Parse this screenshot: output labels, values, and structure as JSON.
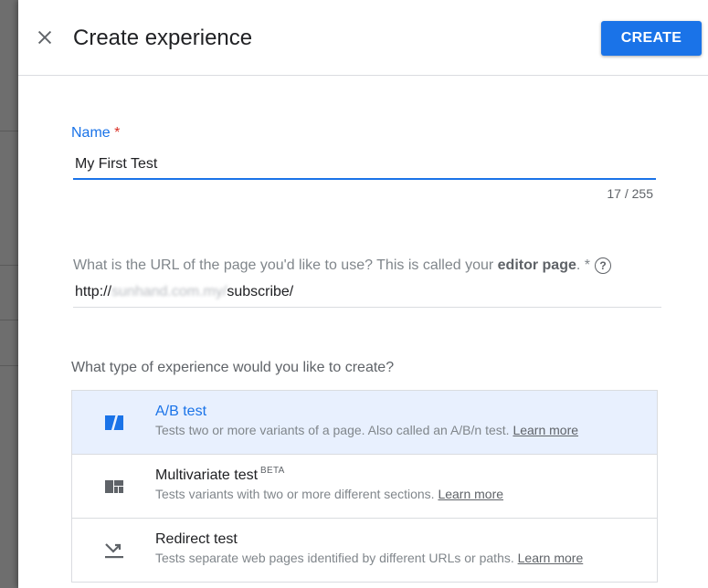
{
  "dialog": {
    "title": "Create experience",
    "create_label": "CREATE"
  },
  "name_field": {
    "label": "Name",
    "required_mark": "*",
    "value": "My First Test",
    "counter": "17 / 255"
  },
  "url_field": {
    "label_prefix": "What is the URL of the page you'd like to use? This is called your ",
    "label_bold": "editor page",
    "label_suffix": ". *",
    "help_glyph": "?",
    "value_prefix": "http://",
    "value_blurred": "sunhand.com.my/",
    "value_suffix": "subscribe/"
  },
  "experience_type": {
    "question": "What type of experience would you like to create?",
    "options": [
      {
        "icon": "ab-test-icon",
        "title": "A/B test",
        "superscript": "",
        "description": "Tests two or more variants of a page. Also called an A/B/n test.",
        "link": "Learn more",
        "selected": true
      },
      {
        "icon": "multivariate-icon",
        "title": "Multivariate test",
        "superscript": "BETA",
        "description": "Tests variants with two or more different sections.",
        "link": "Learn more",
        "selected": false
      },
      {
        "icon": "redirect-icon",
        "title": "Redirect test",
        "superscript": "",
        "description": "Tests separate web pages identified by different URLs or paths.",
        "link": "Learn more",
        "selected": false
      }
    ]
  },
  "colors": {
    "accent": "#1a73e8",
    "required": "#d93025",
    "selected_bg": "#e8f0fe",
    "border": "#dadce0"
  }
}
